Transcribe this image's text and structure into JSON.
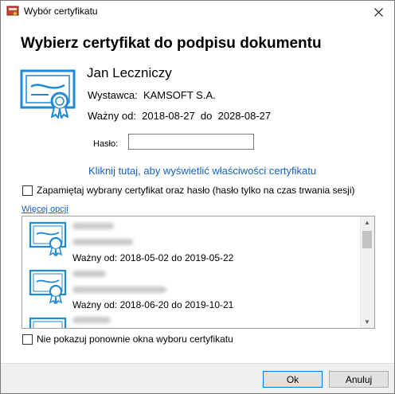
{
  "window": {
    "title": "Wybór certyfikatu"
  },
  "heading": "Wybierz certyfikat do podpisu dokumentu",
  "selected_certificate": {
    "owner": "Jan Leczniczy",
    "issuer_label": "Wystawca:",
    "issuer": "KAMSOFT S.A.",
    "valid_from_label": "Ważny od:",
    "valid_from": "2018-08-27",
    "valid_to_label": "do",
    "valid_to": "2028-08-27"
  },
  "password": {
    "label": "Hasło:",
    "value": ""
  },
  "properties_link": "Kliknij tutaj, aby wyświetlić właściwości certyfikatu",
  "remember_checkbox": {
    "label": "Zapamiętaj wybrany certyfikat oraz hasło (hasło tylko na czas trwania sesji)",
    "checked": false
  },
  "more_options": "Więcej opcji",
  "cert_list": {
    "items": [
      {
        "validity": "Ważny od: 2018-05-02 do 2019-05-22"
      },
      {
        "validity": "Ważny od: 2018-06-20 do 2019-10-21"
      }
    ]
  },
  "dont_show_checkbox": {
    "label": "Nie pokazuj ponownie okna wyboru certyfikatu",
    "checked": false
  },
  "buttons": {
    "ok": "Ok",
    "cancel": "Anuluj"
  },
  "colors": {
    "accent": "#1f8ad2",
    "link": "#1560bd",
    "footer": "#f0f0f0"
  },
  "icons": {
    "app": "certificate-app-icon",
    "close": "close-icon",
    "cert": "certificate-icon"
  }
}
